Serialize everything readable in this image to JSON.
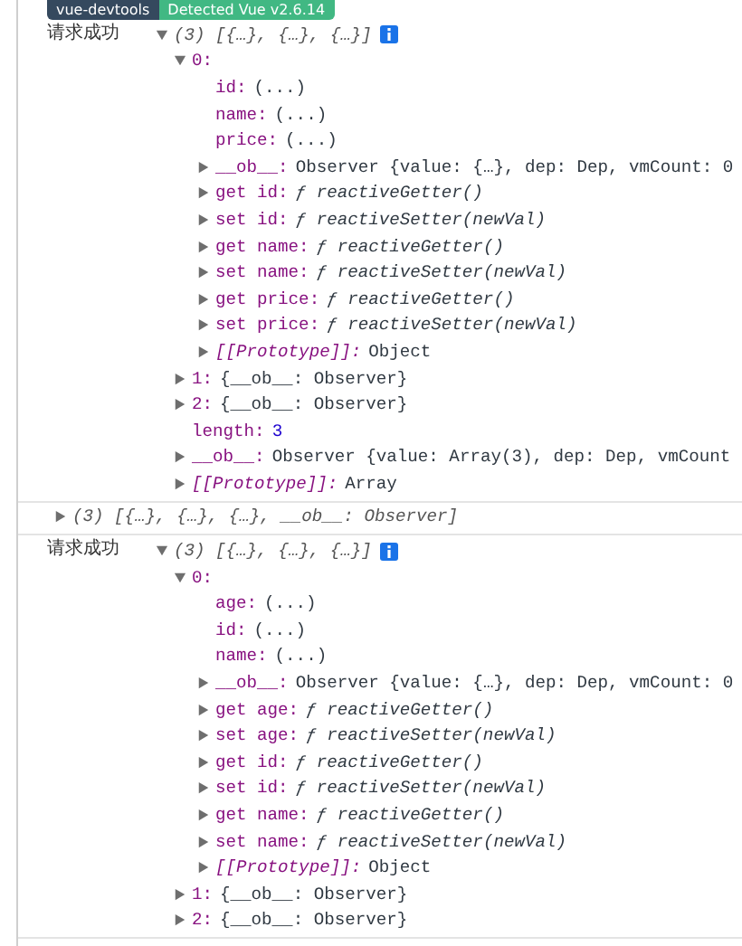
{
  "devtools_badges": [
    {
      "label": "vue-devtools",
      "kind": "dark"
    },
    {
      "label": "Detected Vue v2.6.14",
      "kind": "green"
    }
  ],
  "messages": [
    {
      "label": "请求成功",
      "summary": "(3) [{…}, {…}, {…}]",
      "expanded": true,
      "children": [
        {
          "key": "0:",
          "kind": "index",
          "expanded": true,
          "children": [
            {
              "key": "id:",
              "value": "(...)",
              "kind": "prop"
            },
            {
              "key": "name:",
              "value": "(...)",
              "kind": "prop"
            },
            {
              "key": "price:",
              "value": "(...)",
              "kind": "prop"
            },
            {
              "key": "__ob__:",
              "value": "Observer {value: {…}, dep: Dep, vmCount: 0",
              "kind": "prop",
              "expanded": false
            },
            {
              "key": "get id:",
              "value": "ƒ reactiveGetter()",
              "kind": "accessor",
              "expanded": false
            },
            {
              "key": "set id:",
              "value": "ƒ reactiveSetter(newVal)",
              "kind": "accessor",
              "expanded": false
            },
            {
              "key": "get name:",
              "value": "ƒ reactiveGetter()",
              "kind": "accessor",
              "expanded": false
            },
            {
              "key": "set name:",
              "value": "ƒ reactiveSetter(newVal)",
              "kind": "accessor",
              "expanded": false
            },
            {
              "key": "get price:",
              "value": "ƒ reactiveGetter()",
              "kind": "accessor",
              "expanded": false
            },
            {
              "key": "set price:",
              "value": "ƒ reactiveSetter(newVal)",
              "kind": "accessor",
              "expanded": false
            },
            {
              "key": "[[Prototype]]:",
              "value": "Object",
              "kind": "internal",
              "expanded": false
            }
          ]
        },
        {
          "key": "1:",
          "value": "{__ob__: Observer}",
          "kind": "index",
          "expanded": false
        },
        {
          "key": "2:",
          "value": "{__ob__: Observer}",
          "kind": "index",
          "expanded": false
        },
        {
          "key": "length:",
          "value": "3",
          "kind": "number"
        },
        {
          "key": "__ob__:",
          "value": "Observer {value: Array(3), dep: Dep, vmCount",
          "kind": "prop",
          "expanded": false
        },
        {
          "key": "[[Prototype]]:",
          "value": "Array",
          "kind": "internal",
          "expanded": false
        }
      ]
    },
    {
      "summary": "(3) [{…}, {…}, {…}, __ob__: Observer]",
      "expanded": false
    },
    {
      "label": "请求成功",
      "summary": "(3) [{…}, {…}, {…}]",
      "expanded": true,
      "children": [
        {
          "key": "0:",
          "kind": "index",
          "expanded": true,
          "children": [
            {
              "key": "age:",
              "value": "(...)",
              "kind": "prop"
            },
            {
              "key": "id:",
              "value": "(...)",
              "kind": "prop"
            },
            {
              "key": "name:",
              "value": "(...)",
              "kind": "prop"
            },
            {
              "key": "__ob__:",
              "value": "Observer {value: {…}, dep: Dep, vmCount: 0",
              "kind": "prop",
              "expanded": false
            },
            {
              "key": "get age:",
              "value": "ƒ reactiveGetter()",
              "kind": "accessor",
              "expanded": false
            },
            {
              "key": "set age:",
              "value": "ƒ reactiveSetter(newVal)",
              "kind": "accessor",
              "expanded": false
            },
            {
              "key": "get id:",
              "value": "ƒ reactiveGetter()",
              "kind": "accessor",
              "expanded": false
            },
            {
              "key": "set id:",
              "value": "ƒ reactiveSetter(newVal)",
              "kind": "accessor",
              "expanded": false
            },
            {
              "key": "get name:",
              "value": "ƒ reactiveGetter()",
              "kind": "accessor",
              "expanded": false
            },
            {
              "key": "set name:",
              "value": "ƒ reactiveSetter(newVal)",
              "kind": "accessor",
              "expanded": false
            },
            {
              "key": "[[Prototype]]:",
              "value": "Object",
              "kind": "internal",
              "expanded": false
            }
          ]
        },
        {
          "key": "1:",
          "value": "{__ob__: Observer}",
          "kind": "index",
          "expanded": false
        },
        {
          "key": "2:",
          "value": "{__ob__: Observer}",
          "kind": "index",
          "expanded": false
        }
      ]
    }
  ]
}
